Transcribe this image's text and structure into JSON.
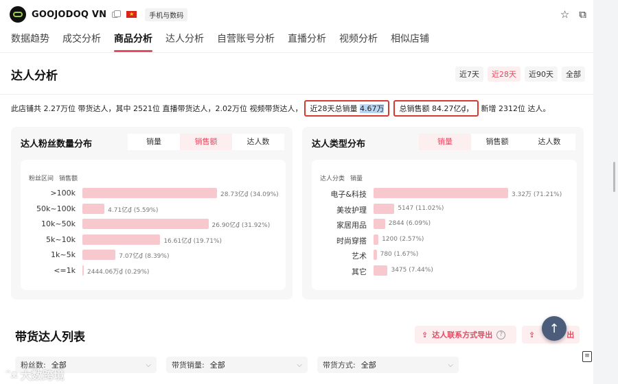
{
  "header": {
    "shop_name": "GOOJODOQ VN",
    "category_tag": "手机与数码"
  },
  "nav": {
    "tabs": [
      "数据趋势",
      "成交分析",
      "商品分析",
      "达人分析",
      "自营账号分析",
      "直播分析",
      "视频分析",
      "相似店铺"
    ],
    "active_index": 2
  },
  "section": {
    "title": "达人分析",
    "ranges": [
      "近7天",
      "近28天",
      "近90天",
      "全部"
    ],
    "active_range_index": 1
  },
  "summary": {
    "prefix": "此店铺共 2.27万位 带货达人，其中 2521位 直播带货达人，2.02万位 视频带货达人，",
    "box1_prefix": "近28天总销量",
    "box1_value": "4.67万",
    "box2_text": "总销售额 84.27亿₫，",
    "suffix": "新增 2312位 达人。"
  },
  "fans_card": {
    "title": "达人粉丝数量分布",
    "tabs": [
      "销量",
      "销售额",
      "达人数"
    ],
    "active_tab_index": 1,
    "col_header_1": "粉丝区间",
    "col_header_2": "销售额",
    "rows": [
      {
        "label": ">100k",
        "value_text": "28.73亿₫ (34.09%)",
        "percent": 34.09
      },
      {
        "label": "50k~100k",
        "value_text": "4.71亿₫ (5.59%)",
        "percent": 5.59
      },
      {
        "label": "10k~50k",
        "value_text": "26.90亿₫ (31.92%)",
        "percent": 31.92
      },
      {
        "label": "5k~10k",
        "value_text": "16.61亿₫ (19.71%)",
        "percent": 19.71
      },
      {
        "label": "1k~5k",
        "value_text": "7.07亿₫ (8.39%)",
        "percent": 8.39
      },
      {
        "label": "<=1k",
        "value_text": "2444.06万₫ (0.29%)",
        "percent": 0.29
      }
    ]
  },
  "type_card": {
    "title": "达人类型分布",
    "tabs": [
      "销量",
      "销售额",
      "达人数"
    ],
    "active_tab_index": 0,
    "col_header_1": "达人分类",
    "col_header_2": "销量",
    "rows": [
      {
        "label": "电子&科技",
        "value_text": "3.32万 (71.21%)",
        "percent": 71.21
      },
      {
        "label": "美妆护理",
        "value_text": "5147 (11.02%)",
        "percent": 11.02
      },
      {
        "label": "家居用品",
        "value_text": "2844 (6.09%)",
        "percent": 6.09
      },
      {
        "label": "时尚穿搭",
        "value_text": "1200 (2.57%)",
        "percent": 2.57
      },
      {
        "label": "艺术",
        "value_text": "780 (1.67%)",
        "percent": 1.67
      },
      {
        "label": "其它",
        "value_text": "3475 (7.44%)",
        "percent": 7.44
      }
    ]
  },
  "list": {
    "title": "带货达人列表",
    "export_contact_label": "达人联系方式导出",
    "export_label": "出"
  },
  "filters": [
    {
      "label": "粉丝数:",
      "value": "全部"
    },
    {
      "label": "带货销量:",
      "value": "全部"
    },
    {
      "label": "带货方式:",
      "value": "全部"
    }
  ],
  "watermark": "大数跨境",
  "icons": {
    "favorite": "star-icon",
    "open_external": "external-link-icon",
    "back_to_top": "arrow-up-icon",
    "export": "upload-icon",
    "doc": "document-icon"
  },
  "colors": {
    "accent": "#e64a62",
    "bar": "#f7c9ce",
    "highlight_box": "#d63a2f"
  }
}
